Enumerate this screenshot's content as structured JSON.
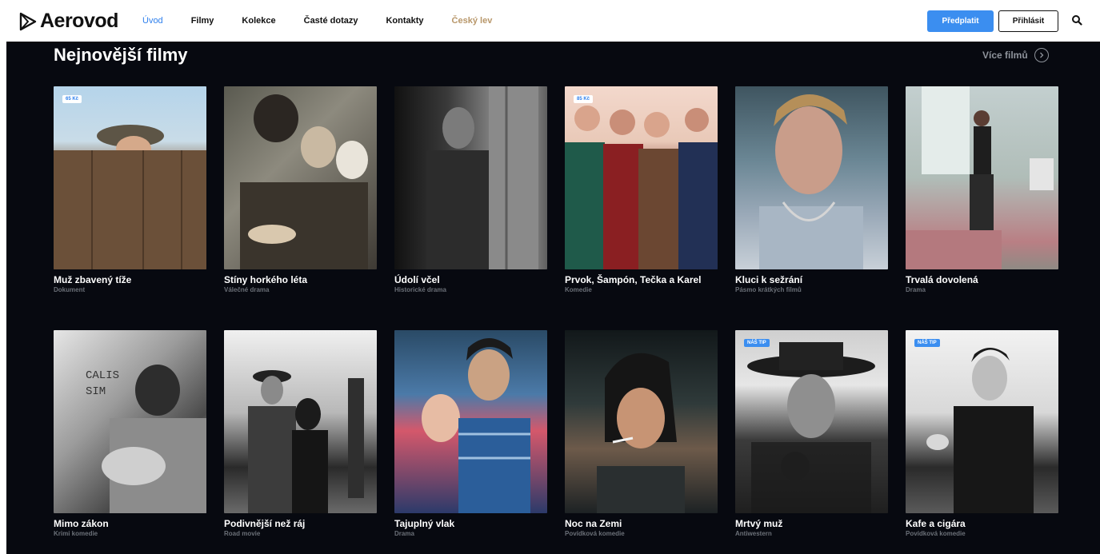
{
  "brand": {
    "name": "Aerovod"
  },
  "nav": [
    {
      "label": "Úvod",
      "active": true
    },
    {
      "label": "Filmy"
    },
    {
      "label": "Kolekce"
    },
    {
      "label": "Časté dotazy"
    },
    {
      "label": "Kontakty"
    },
    {
      "label": "Český lev"
    }
  ],
  "header_actions": {
    "subscribe": "Předplatit",
    "login": "Přihlásit",
    "search_icon": "search-icon"
  },
  "section": {
    "title": "Nejnovější filmy",
    "more": "Více filmů"
  },
  "colors": {
    "accent": "#3b8ef0",
    "active_nav": "#2f80ed",
    "gold": "#b8976a",
    "background": "#070910"
  },
  "films": [
    {
      "title": "Muž zbavený tíže",
      "genre": "Dokument",
      "badge": "65 Kč"
    },
    {
      "title": "Stíny horkého léta",
      "genre": "Válečné drama",
      "badge": ""
    },
    {
      "title": "Údolí včel",
      "genre": "Historické drama",
      "badge": ""
    },
    {
      "title": "Prvok, Šampón, Tečka a Karel",
      "genre": "Komedie",
      "badge": "85 Kč"
    },
    {
      "title": "Kluci k sežrání",
      "genre": "Pásmo krátkých filmů",
      "badge": ""
    },
    {
      "title": "Trvalá dovolená",
      "genre": "Drama",
      "badge": ""
    },
    {
      "title": "Mimo zákon",
      "genre": "Krimi komedie",
      "badge": ""
    },
    {
      "title": "Podivnější než ráj",
      "genre": "Road movie",
      "badge": ""
    },
    {
      "title": "Tajuplný vlak",
      "genre": "Drama",
      "badge": ""
    },
    {
      "title": "Noc na Zemi",
      "genre": "Povídková komedie",
      "badge": ""
    },
    {
      "title": "Mrtvý muž",
      "genre": "Antiwestern",
      "badge": "NÁŠ TIP"
    },
    {
      "title": "Kafe a cigára",
      "genre": "Povídková komedie",
      "badge": "NÁŠ TIP"
    }
  ]
}
